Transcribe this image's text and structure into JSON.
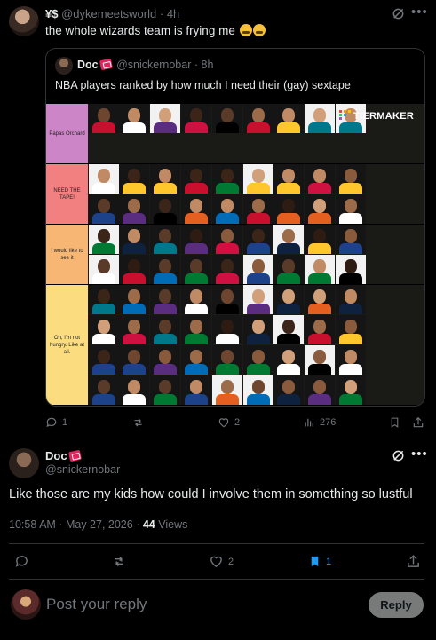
{
  "top_tweet": {
    "display_name": "¥$",
    "handle": "@dykemeetsworld",
    "separator": "·",
    "age": "4h",
    "text": "the whole wizards team is frying me",
    "emoji_count": 2,
    "more_icon": "more-horizontal-icon",
    "grok_icon": "grok-icon"
  },
  "quote": {
    "display_name": "Doc",
    "handle": "@snickernobar",
    "separator": "·",
    "age": "8h",
    "text": "NBA players ranked by how much I need their (gay) sextape",
    "tiermaker_logo": "TIERMAKER",
    "tiers": [
      {
        "label": "Papas Orchard",
        "color": "#cc85c6",
        "rows": 2,
        "players": 9
      },
      {
        "label": "NEED THE TAPE!",
        "color": "#f28080",
        "rows": 2,
        "players": 20
      },
      {
        "label": "I would like to see it",
        "color": "#f7b673",
        "rows": 2,
        "players": 20
      },
      {
        "label": "Oh, I'm not hungry. Like at all.",
        "color": "#fbdd80",
        "rows": 4,
        "players": 36
      }
    ]
  },
  "top_actions": {
    "replies": "1",
    "reposts": "",
    "likes": "2",
    "views": "276"
  },
  "reply": {
    "display_name": "Doc",
    "handle": "@snickernobar",
    "text": "Like those are my kids how could I involve them in something so lustful",
    "time": "10:58 AM",
    "date": "May 27, 2026",
    "separator": "·",
    "views_count": "44",
    "views_label": "Views",
    "likes": "2",
    "bookmarks": "1"
  },
  "compose": {
    "placeholder": "Post your reply",
    "button_label": "Reply"
  },
  "colors": {
    "background": "#000000",
    "text": "#e7e9ea",
    "muted": "#71767b",
    "border": "#2f3336",
    "bookmark_active": "#1d9bf0",
    "reply_button": "#787a7a"
  }
}
